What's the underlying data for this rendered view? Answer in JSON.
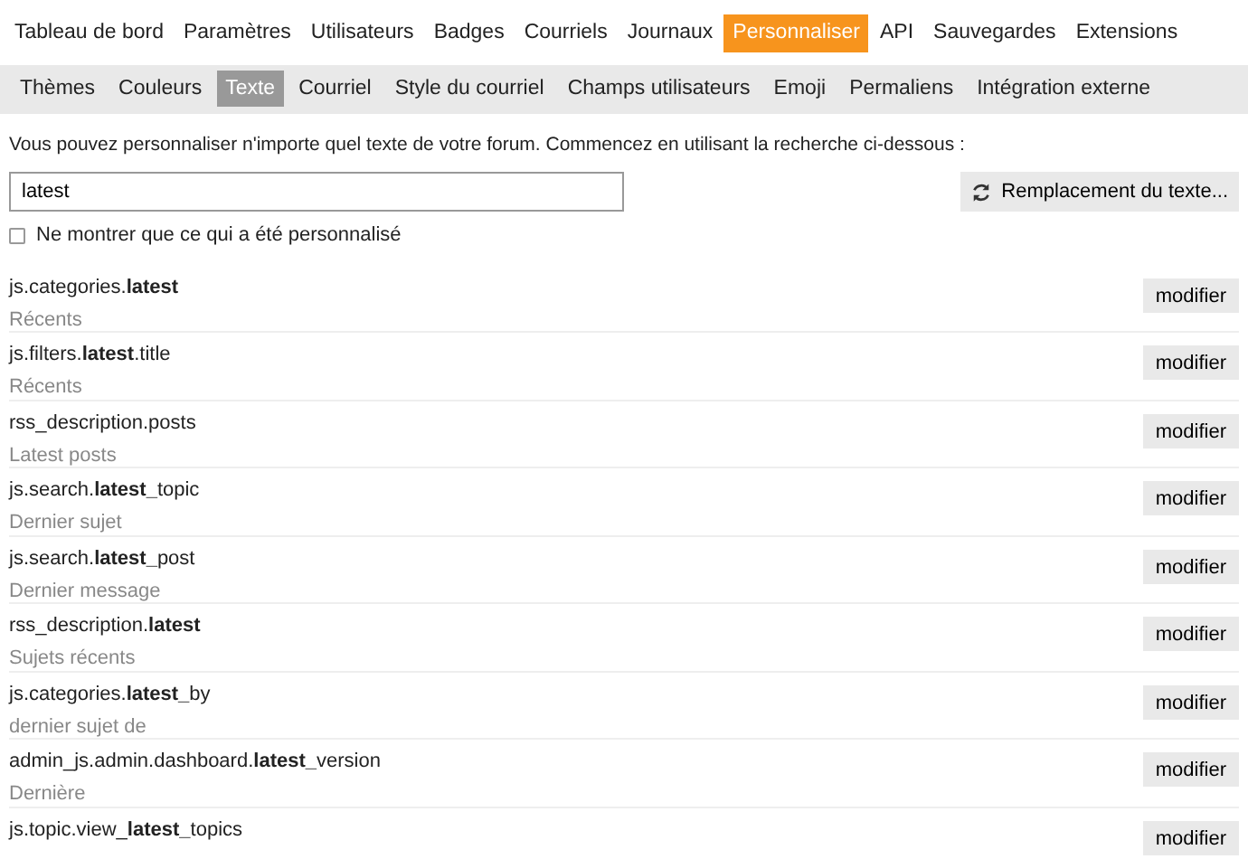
{
  "main_nav": [
    {
      "label": "Tableau de bord",
      "selected": false
    },
    {
      "label": "Paramètres",
      "selected": false
    },
    {
      "label": "Utilisateurs",
      "selected": false
    },
    {
      "label": "Badges",
      "selected": false
    },
    {
      "label": "Courriels",
      "selected": false
    },
    {
      "label": "Journaux",
      "selected": false
    },
    {
      "label": "Personnaliser",
      "selected": true
    },
    {
      "label": "API",
      "selected": false
    },
    {
      "label": "Sauvegardes",
      "selected": false
    },
    {
      "label": "Extensions",
      "selected": false
    }
  ],
  "sub_nav": [
    {
      "label": "Thèmes",
      "selected": false
    },
    {
      "label": "Couleurs",
      "selected": false
    },
    {
      "label": "Texte",
      "selected": true
    },
    {
      "label": "Courriel",
      "selected": false
    },
    {
      "label": "Style du courriel",
      "selected": false
    },
    {
      "label": "Champs utilisateurs",
      "selected": false
    },
    {
      "label": "Emoji",
      "selected": false
    },
    {
      "label": "Permaliens",
      "selected": false
    },
    {
      "label": "Intégration externe",
      "selected": false
    }
  ],
  "intro": "Vous pouvez personnaliser n'importe quel texte de votre forum. Commencez en utilisant la recherche ci-dessous :",
  "search": {
    "value": "latest"
  },
  "replace_button": "Remplacement du texte...",
  "only_customized": {
    "label": "Ne montrer que ce qui a été personnalisé",
    "checked": false
  },
  "results": [
    {
      "key": "js.categories.**latest**",
      "value": "Récents",
      "button": "modifier"
    },
    {
      "key": "js.filters.**latest**.title",
      "value": "Récents",
      "button": "modifier"
    },
    {
      "key": "rss_description.posts",
      "value": "Latest posts",
      "button": "modifier"
    },
    {
      "key": "js.search.**latest_**topic",
      "value": "Dernier sujet",
      "button": "modifier"
    },
    {
      "key": "js.search.**latest_**post",
      "value": "Dernier message",
      "button": "modifier"
    },
    {
      "key": "rss_description.**latest**",
      "value": "Sujets récents",
      "button": "modifier"
    },
    {
      "key": "js.categories.**latest_**by",
      "value": "dernier sujet de",
      "button": "modifier"
    },
    {
      "key": "admin_js.admin.dashboard.**latest_**version",
      "value": "Dernière",
      "button": "modifier"
    },
    {
      "key": "js.topic.view_**latest_**topics",
      "button": "modifier"
    }
  ]
}
